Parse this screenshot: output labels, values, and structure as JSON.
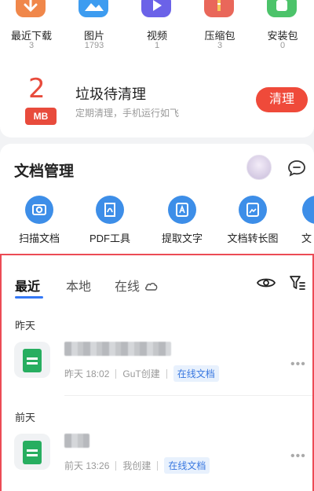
{
  "categories": [
    {
      "name": "最近下载",
      "count": "3",
      "color": "#f0874a",
      "icon": "download-icon"
    },
    {
      "name": "图片",
      "count": "1793",
      "color": "#3d9cf0",
      "icon": "image-icon"
    },
    {
      "name": "视频",
      "count": "1",
      "color": "#6b62e8",
      "icon": "video-icon"
    },
    {
      "name": "压缩包",
      "count": "3",
      "color": "#e9675a",
      "icon": "zip-icon"
    },
    {
      "name": "安装包",
      "count": "0",
      "color": "#4cc36a",
      "icon": "android-icon"
    }
  ],
  "trash": {
    "number": "2",
    "unit": "MB",
    "title": "垃圾待清理",
    "subtitle": "定期清理，手机运行如飞",
    "button": "清理"
  },
  "doc_management": {
    "title": "文档管理",
    "tools": [
      {
        "label": "扫描文档",
        "icon": "camera-icon"
      },
      {
        "label": "PDF工具",
        "icon": "pdf-icon"
      },
      {
        "label": "提取文字",
        "icon": "text-extract-icon"
      },
      {
        "label": "文档转长图",
        "icon": "long-image-icon"
      },
      {
        "label": "文",
        "icon": "doc-icon"
      }
    ]
  },
  "files": {
    "tabs": [
      "最近",
      "本地",
      "在线"
    ],
    "active_tab": 0,
    "sections": [
      {
        "label": "昨天",
        "items": [
          {
            "time": "昨天 18:02",
            "creator": "GuT创建",
            "tag": "在线文档"
          }
        ]
      },
      {
        "label": "前天",
        "items": [
          {
            "time": "前天 13:26",
            "creator": "我创建",
            "tag": "在线文档"
          }
        ]
      }
    ]
  },
  "colors": {
    "accent_red": "#ef4a3a",
    "accent_blue": "#3478f6",
    "sheet_green": "#27ae60",
    "highlight_border": "#ec4b55"
  }
}
